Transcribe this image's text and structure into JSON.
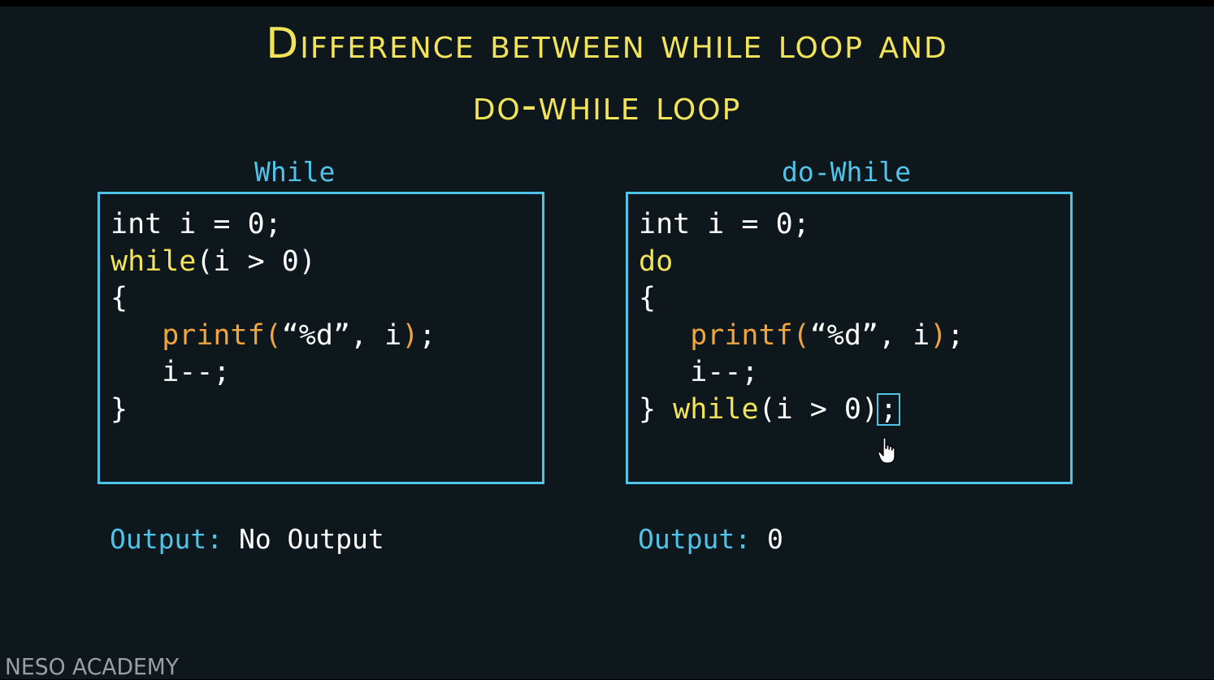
{
  "slide": {
    "title_line1": "Difference between while loop and",
    "title_line2": "do-while loop"
  },
  "while_column": {
    "heading": "While",
    "code": {
      "line1": "int i = 0;",
      "line2_kw": "while",
      "line2_rest": "(i > 0)",
      "line3": "{",
      "line4_fn": "printf",
      "line4_paren_open": "(",
      "line4_args": "“%d”, i",
      "line4_paren_close": ")",
      "line4_semi": ";",
      "line5": "i--;",
      "line6": "}"
    },
    "output_label": "Output:",
    "output_value": "No Output"
  },
  "do_while_column": {
    "heading": "do-While",
    "code": {
      "line1": "int i = 0;",
      "line2_kw": "do",
      "line3": "{",
      "line4_fn": "printf",
      "line4_paren_open": "(",
      "line4_args": "“%d”, i",
      "line4_paren_close": ")",
      "line4_semi": ";",
      "line5": "i--;",
      "line6_brace": "}",
      "line6_kw": "while",
      "line6_rest": "(i > 0)",
      "line6_semi": ";"
    },
    "output_label": "Output:",
    "output_value": "0"
  },
  "watermark": "NESO ACADEMY",
  "colors": {
    "background": "#0e181c",
    "title": "#f2e35b",
    "accent_blue": "#4fc3e8",
    "keyword": "#f2e35b",
    "function": "#f0a43c",
    "text": "#ffffff"
  },
  "icons": {
    "cursor": "hand-pointer-icon"
  }
}
